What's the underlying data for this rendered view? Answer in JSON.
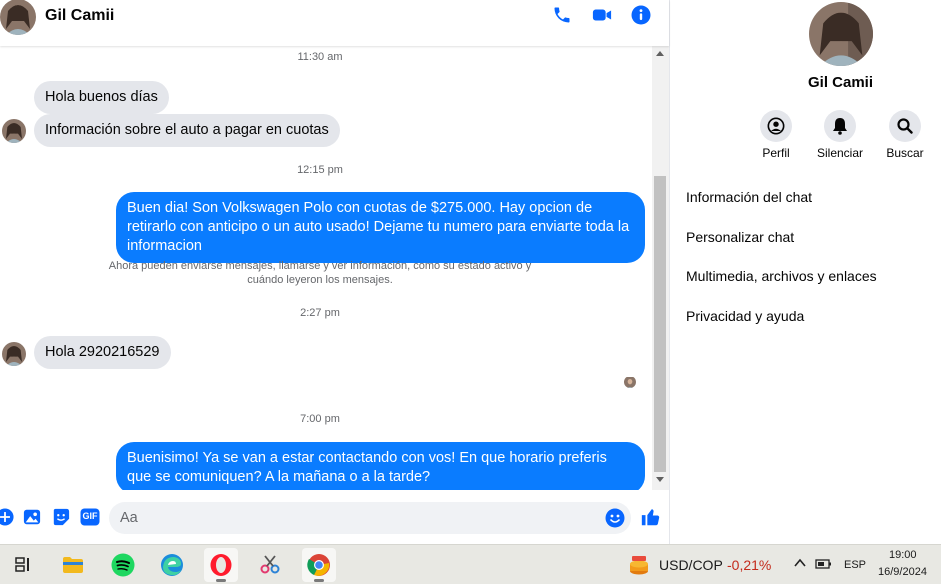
{
  "contact": {
    "name": "Gil Camii"
  },
  "messages": {
    "ts1": "11:30 am",
    "m1": "Hola buenos días",
    "m2": "Información sobre el auto a pagar en cuotas",
    "ts2": "12:15 pm",
    "m3": "Buen dia! Son Volkswagen Polo con cuotas de $275.000. Hay opcion de retirarlo con anticipo o un auto usado! Dejame tu numero para enviarte toda la informacion",
    "system_note": "Ahora pueden enviarse mensajes, llamarse y ver información, como su estado activo y cuándo leyeron los mensajes.",
    "ts3": "2:27 pm",
    "m4": "Hola 2920216529",
    "ts4": "7:00 pm",
    "m5": "Buenisimo! Ya se van a estar contactando con vos! En que horario preferis que se comuniquen? A la mañana o a la tarde?"
  },
  "composer": {
    "placeholder": "Aa",
    "gif_label": "GIF"
  },
  "info": {
    "actions": [
      {
        "label": "Perfil"
      },
      {
        "label": "Silenciar"
      },
      {
        "label": "Buscar"
      }
    ],
    "menu": [
      {
        "label": "Información del chat"
      },
      {
        "label": "Personalizar chat"
      },
      {
        "label": "Multimedia, archivos y enlaces"
      },
      {
        "label": "Privacidad y ayuda"
      }
    ]
  },
  "taskbar": {
    "currency_pair": "USD/COP",
    "currency_change": "-0,21%",
    "language": "ESP",
    "time": "19:00",
    "date": "16/9/2024"
  },
  "colors": {
    "accent": "#0a7cff",
    "icon_blue": "#0866ff",
    "incoming_bubble": "#e4e6eb",
    "negative": "#c42b1c"
  }
}
